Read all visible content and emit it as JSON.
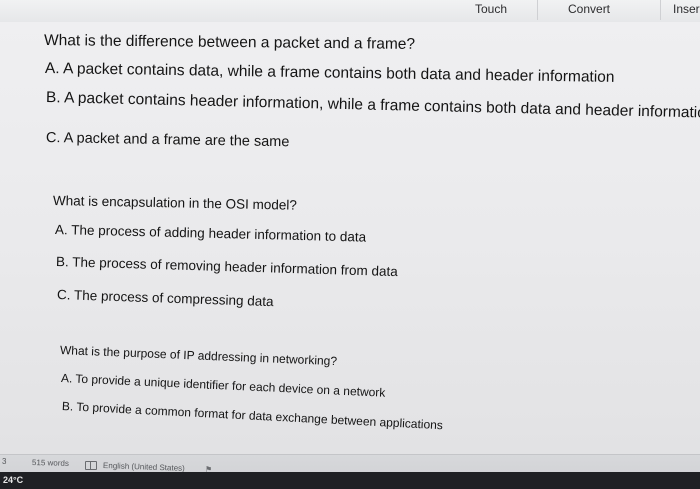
{
  "toolbar": {
    "touch": "Touch",
    "convert": "Convert",
    "insert": "Inser"
  },
  "questions": [
    {
      "question": "What is the difference between a packet and a frame?",
      "options": [
        "A. A packet contains data, while a frame contains both data and header information",
        "B. A packet contains header information, while a frame contains both data and header information",
        "C. A packet and a frame are the same"
      ]
    },
    {
      "question": "What is encapsulation in the OSI model?",
      "options": [
        "A. The process of adding header information to data",
        "B. The process of removing header information from data",
        "C. The process of compressing data"
      ]
    },
    {
      "question": "What is the purpose of IP addressing in networking?",
      "options": [
        "A. To provide a unique identifier for each device on a network",
        "B. To provide a common format for data exchange between applications"
      ]
    }
  ],
  "statusbar": {
    "page": "3",
    "words": "515 words",
    "language": "English (United States)"
  },
  "taskbar": {
    "temperature": "24°C"
  }
}
